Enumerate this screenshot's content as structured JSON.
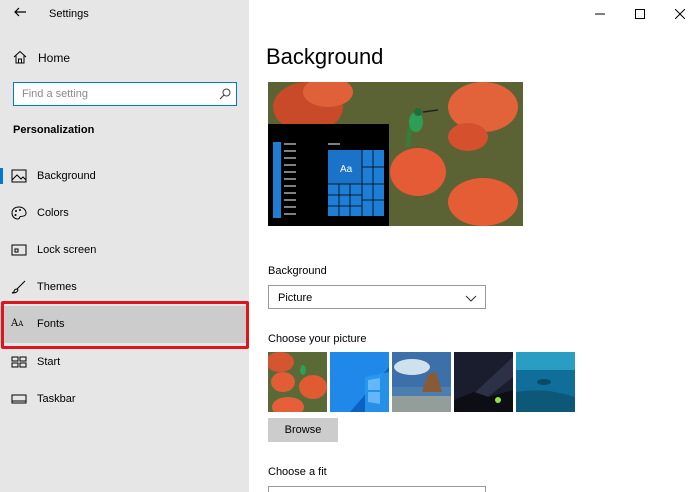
{
  "app": {
    "title": "Settings"
  },
  "sidebar": {
    "home_label": "Home",
    "search_placeholder": "Find a setting",
    "section_title": "Personalization",
    "items": [
      {
        "label": "Background",
        "icon": "picture-icon",
        "selected": true
      },
      {
        "label": "Colors",
        "icon": "palette-icon"
      },
      {
        "label": "Lock screen",
        "icon": "lock-screen-icon"
      },
      {
        "label": "Themes",
        "icon": "brush-icon"
      },
      {
        "label": "Fonts",
        "icon": "fonts-icon",
        "highlighted": true
      },
      {
        "label": "Start",
        "icon": "start-icon"
      },
      {
        "label": "Taskbar",
        "icon": "taskbar-icon"
      }
    ]
  },
  "main": {
    "page_title": "Background",
    "preview_tile_text": "Aa",
    "background_label": "Background",
    "background_value": "Picture",
    "choose_picture_label": "Choose your picture",
    "browse_label": "Browse",
    "choose_fit_label": "Choose a fit"
  },
  "colors": {
    "accent": "#0078d4",
    "highlight_frame": "#e0141c",
    "sidebar_bg": "#e6e6e6"
  }
}
